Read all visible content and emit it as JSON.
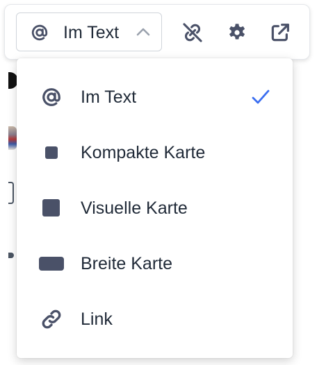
{
  "toolbar": {
    "selected_type": {
      "label": "Im Text",
      "icon": "at-icon"
    },
    "buttons": [
      {
        "icon": "unlink-icon"
      },
      {
        "icon": "gear-icon"
      },
      {
        "icon": "external-link-icon"
      }
    ]
  },
  "menu": {
    "items": [
      {
        "label": "Im Text",
        "icon": "at-icon",
        "selected": true
      },
      {
        "label": "Kompakte Karte",
        "icon": "small-square-icon",
        "selected": false
      },
      {
        "label": "Visuelle Karte",
        "icon": "square-icon",
        "selected": false
      },
      {
        "label": "Breite Karte",
        "icon": "wide-rectangle-icon",
        "selected": false
      },
      {
        "label": "Link",
        "icon": "link-icon",
        "selected": false
      }
    ]
  },
  "colors": {
    "icon": "#4a5168",
    "text": "#1f2937",
    "check": "#3b6ef0",
    "border": "#cfd4da"
  }
}
